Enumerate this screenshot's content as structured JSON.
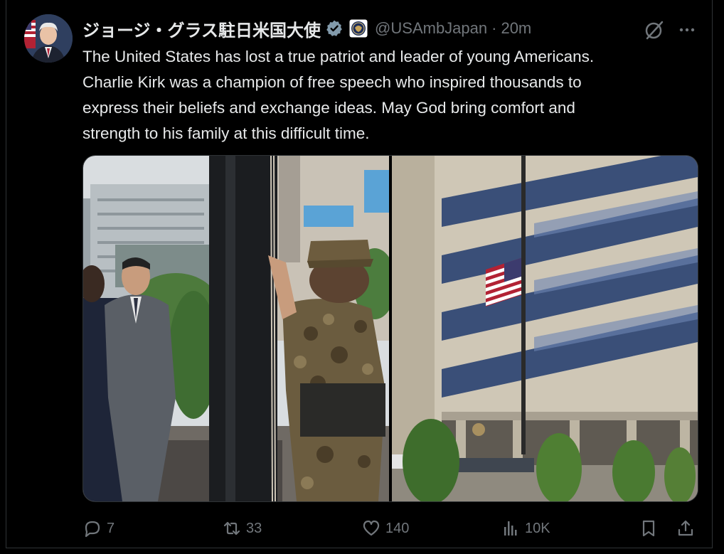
{
  "post": {
    "display_name": "ジョージ・グラス駐日米国大使",
    "handle": "@USAmbJapan",
    "separator": "·",
    "time": "20m",
    "text": [
      "The United States has lost a true patriot and leader of young Americans.",
      "Charlie Kirk was a champion of free speech who inspired thousands to",
      "express their beliefs and exchange ideas. May God bring comfort and",
      "strength to his family at this difficult time."
    ]
  },
  "actions": {
    "reply": {
      "icon": "reply-icon",
      "count": "7"
    },
    "repost": {
      "icon": "repost-icon",
      "count": "33"
    },
    "like": {
      "icon": "heart-icon",
      "count": "140"
    },
    "views": {
      "icon": "views-icon",
      "count": "10K"
    },
    "bookmark": {
      "icon": "bookmark-icon"
    },
    "share": {
      "icon": "share-icon"
    }
  },
  "colors": {
    "background": "#000000",
    "text": "#e7e9ea",
    "muted": "#71767b",
    "border": "#2f3336"
  }
}
